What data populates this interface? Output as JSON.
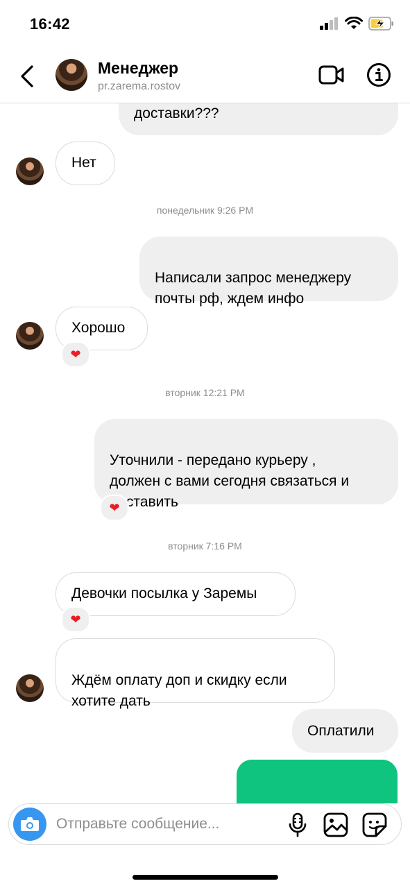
{
  "status_bar": {
    "time": "16:42"
  },
  "header": {
    "name": "Менеджер",
    "handle": "pr.zarema.rostov"
  },
  "messages": [
    {
      "text": "доставки???"
    },
    {
      "text": "Нет"
    },
    {
      "text": "Написали запрос менеджеру\nпочты рф, ждем инфо"
    },
    {
      "text": "Хорошо",
      "reaction": "❤"
    },
    {
      "text": "Уточнили - передано курьеру ,\nдолжен с вами сегодня связаться и\nдоставить",
      "reaction": "❤"
    },
    {
      "text": "Девочки посылка у Заремы",
      "reaction": "❤"
    },
    {
      "text": "Ждём оплату доп и скидку если\nхотите дать"
    },
    {
      "text": "Оплатили"
    }
  ],
  "timestamps": [
    "понедельник 9:26 PM",
    "вторник 12:21 PM",
    "вторник 7:16 PM"
  ],
  "composer": {
    "placeholder": "Отправьте сообщение..."
  },
  "colors": {
    "accent": "#3797f0",
    "reaction": "#ed1c24",
    "media": "#0ec47f",
    "outgoing_bubble": "#efefef"
  },
  "icons": [
    "back-icon",
    "video-call-icon",
    "info-icon",
    "camera-icon",
    "microphone-icon",
    "gallery-icon",
    "sticker-icon",
    "heart-icon"
  ]
}
